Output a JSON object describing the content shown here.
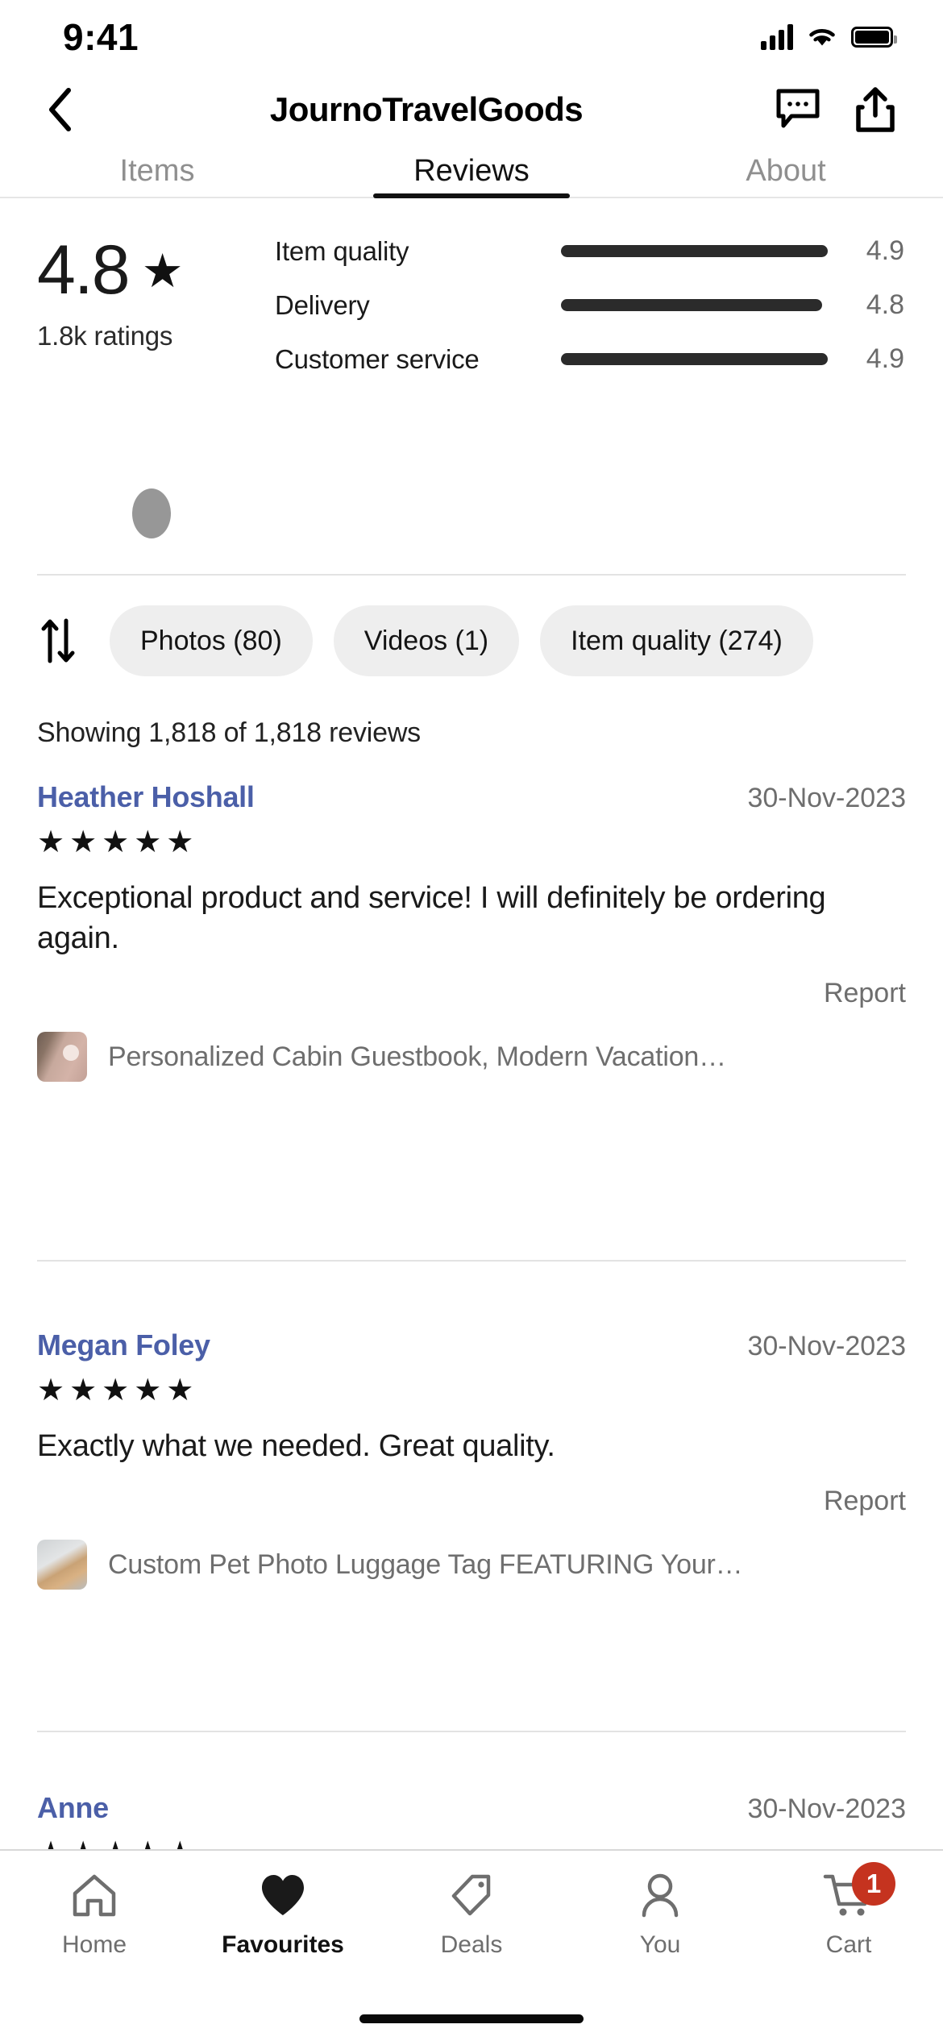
{
  "status_bar": {
    "time": "9:41",
    "signal_icon": "cellular-signal-icon",
    "wifi_icon": "wifi-icon",
    "battery_icon": "battery-icon"
  },
  "nav": {
    "back_icon": "chevron-left-icon",
    "title": "JournoTravelGoods",
    "message_icon": "message-bubble-icon",
    "share_icon": "share-icon"
  },
  "tabs": [
    {
      "label": "Items",
      "active": false
    },
    {
      "label": "Reviews",
      "active": true
    },
    {
      "label": "About",
      "active": false
    }
  ],
  "rating_summary": {
    "score": "4.8",
    "star_icon": "star-filled-icon",
    "count_label": "1.8k ratings",
    "breakdown": [
      {
        "label": "Item quality",
        "value": "4.9",
        "percent": 98
      },
      {
        "label": "Delivery",
        "value": "4.8",
        "percent": 96
      },
      {
        "label": "Customer service",
        "value": "4.9",
        "percent": 98
      }
    ]
  },
  "filters": {
    "sort_icon": "sort-arrows-icon",
    "chips": [
      {
        "label": "Photos (80)"
      },
      {
        "label": "Videos (1)"
      },
      {
        "label": "Item quality (274)"
      }
    ]
  },
  "showing_text": "Showing 1,818 of 1,818 reviews",
  "reviews": [
    {
      "name": "Heather Hoshall",
      "date": "30-Nov-2023",
      "stars": "★★★★★",
      "text": "Exceptional product and service! I will definitely be ordering again.",
      "report_label": "Report",
      "item_title": "Personalized Cabin Guestbook, Modern Vacation…",
      "thumb": "guestbook-photo"
    },
    {
      "name": "Megan Foley",
      "date": "30-Nov-2023",
      "stars": "★★★★★",
      "text": "Exactly what we needed. Great quality.",
      "report_label": "Report",
      "item_title": "Custom Pet Photo Luggage Tag FEATURING Your…",
      "thumb": "luggage-tag-photo"
    },
    {
      "name": "Anne",
      "date": "30-Nov-2023",
      "stars": "★★★★★",
      "text": "",
      "report_label": "",
      "item_title": "",
      "thumb": ""
    }
  ],
  "bottom_tabs": [
    {
      "label": "Home",
      "icon": "home-icon",
      "active": false,
      "badge": ""
    },
    {
      "label": "Favourites",
      "icon": "heart-filled-icon",
      "active": true,
      "badge": ""
    },
    {
      "label": "Deals",
      "icon": "tag-icon",
      "active": false,
      "badge": ""
    },
    {
      "label": "You",
      "icon": "person-icon",
      "active": false,
      "badge": ""
    },
    {
      "label": "Cart",
      "icon": "shopping-cart-icon",
      "active": false,
      "badge": "1"
    }
  ],
  "colors": {
    "accent_link": "#4b5fa8",
    "badge_red": "#c5331f",
    "chip_bg": "#eeeeee",
    "muted": "#6e6e6e"
  }
}
